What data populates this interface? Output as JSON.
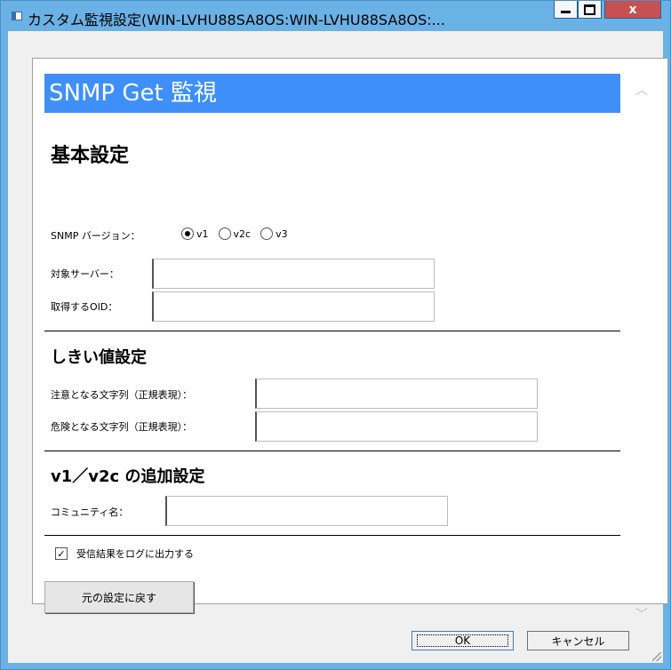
{
  "window": {
    "title": "カスタム監視設定(WIN-LVHU88SA8OS:WIN-LVHU88SA8OS:...",
    "minimize_icon": "minimize-icon",
    "maximize_icon": "maximize-icon",
    "close_label": "x"
  },
  "panel": {
    "banner_title": "SNMP Get 監視",
    "basic": {
      "title": "基本設定",
      "snmp_version_label": "SNMP バージョン：",
      "versions": [
        {
          "label": "v1",
          "selected": true
        },
        {
          "label": "v2c",
          "selected": false
        },
        {
          "label": "v3",
          "selected": false
        }
      ],
      "target_server_label": "対象サーバー：",
      "target_server_value": "",
      "oid_label": "取得するOID：",
      "oid_value": ""
    },
    "threshold": {
      "title": "しきい値設定",
      "warning_label": "注意となる文字列（正規表現）：",
      "warning_value": "",
      "critical_label": "危険となる文字列（正規表現）：",
      "critical_value": ""
    },
    "v1v2c": {
      "title": "v1／v2c の追加設定",
      "community_label": "コミュニティ名：",
      "community_value": ""
    },
    "log_checkbox": {
      "label": "受信結果をログに出力する",
      "checked": true,
      "mark": "✓"
    },
    "reset_button": "元の設定に戻す",
    "scroll_up": "︿",
    "scroll_down": "﹀"
  },
  "footer": {
    "ok_label": "OK",
    "cancel_label": "キャンセル"
  }
}
